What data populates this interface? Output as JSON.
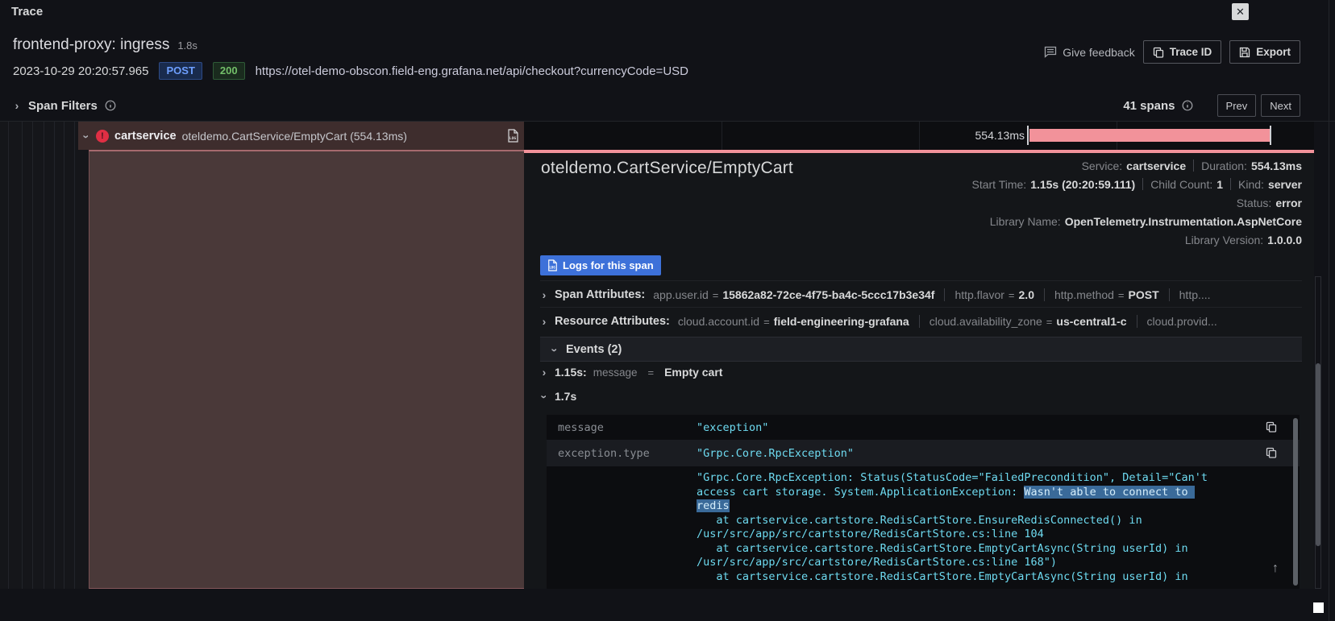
{
  "topbar": {
    "title": "Trace"
  },
  "header": {
    "title": "frontend-proxy: ingress",
    "trace_duration": "1.8s",
    "timestamp": "2023-10-29 20:20:57.965",
    "method": "POST",
    "status_code": "200",
    "url": "https://otel-demo-obscon.field-eng.grafana.net/api/checkout?currencyCode=USD",
    "feedback_label": "Give feedback",
    "trace_id_label": "Trace ID",
    "export_label": "Export"
  },
  "filter_bar": {
    "span_filters_label": "Span Filters",
    "span_count": "41 spans",
    "prev_label": "Prev",
    "next_label": "Next"
  },
  "trace_view": {
    "span_row": {
      "service": "cartservice",
      "operation": "oteldemo.CartService/EmptyCart (554.13ms)"
    },
    "timeline": {
      "duration_label": "554.13ms"
    }
  },
  "span_detail": {
    "title": "oteldemo.CartService/EmptyCart",
    "meta": {
      "service_label": "Service:",
      "service": "cartservice",
      "duration_label": "Duration:",
      "duration": "554.13ms",
      "start_time_label": "Start Time:",
      "start_time": "1.15s (20:20:59.111)",
      "child_count_label": "Child Count:",
      "child_count": "1",
      "kind_label": "Kind:",
      "kind": "server",
      "status_label": "Status:",
      "status": "error",
      "library_name_label": "Library Name:",
      "library_name": "OpenTelemetry.Instrumentation.AspNetCore",
      "library_version_label": "Library Version:",
      "library_version": "1.0.0.0"
    },
    "logs_button_label": "Logs for this span",
    "span_attributes": {
      "label": "Span Attributes:",
      "attrs": [
        {
          "key": "app.user.id",
          "value": "15862a82-72ce-4f75-ba4c-5ccc17b3e34f"
        },
        {
          "key": "http.flavor",
          "value": "2.0"
        },
        {
          "key": "http.method",
          "value": "POST"
        },
        {
          "key": "http....",
          "value": ""
        }
      ]
    },
    "resource_attributes": {
      "label": "Resource Attributes:",
      "attrs": [
        {
          "key": "cloud.account.id",
          "value": "field-engineering-grafana"
        },
        {
          "key": "cloud.availability_zone",
          "value": "us-central1-c"
        },
        {
          "key": "cloud.provid...",
          "value": ""
        }
      ]
    },
    "events": {
      "header": "Events (2)",
      "event1": {
        "time": "1.15s:",
        "key": "message",
        "value": "Empty cart"
      },
      "event2": {
        "time": "1.7s"
      },
      "table": {
        "rows": [
          {
            "key": "message",
            "value": "\"exception\""
          },
          {
            "key": "exception.type",
            "value": "\"Grpc.Core.RpcException\""
          },
          {
            "key": "",
            "value_pre": "\"Grpc.Core.RpcException: Status(StatusCode=\"FailedPrecondition\", Detail=\"Can't access cart storage. System.ApplicationException: ",
            "value_highlight": "Wasn't able to connect to redis",
            "value_post": "\n   at cartservice.cartstore.RedisCartStore.EnsureRedisConnected() in /usr/src/app/src/cartstore/RedisCartStore.cs:line 104\n   at cartservice.cartstore.RedisCartStore.EmptyCartAsync(String userId) in /usr/src/app/src/cartstore/RedisCartStore.cs:line 168\")\n   at cartservice.cartstore.RedisCartStore.EmptyCartAsync(String userId) in"
          }
        ]
      }
    }
  },
  "icons": {
    "close": "✕",
    "chevron": "›",
    "up_arrow": "↑",
    "error_bang": "!"
  },
  "misc": {
    "eq": "="
  },
  "colors": {
    "accent_blue": "#3d71d9",
    "error_red": "#e02f44",
    "bar_pink": "#f2929a",
    "code_cyan": "#6edbf1",
    "method_blue": "#6e9fff",
    "status_green": "#73bf69",
    "selected_span_bg": "#4a3939"
  }
}
